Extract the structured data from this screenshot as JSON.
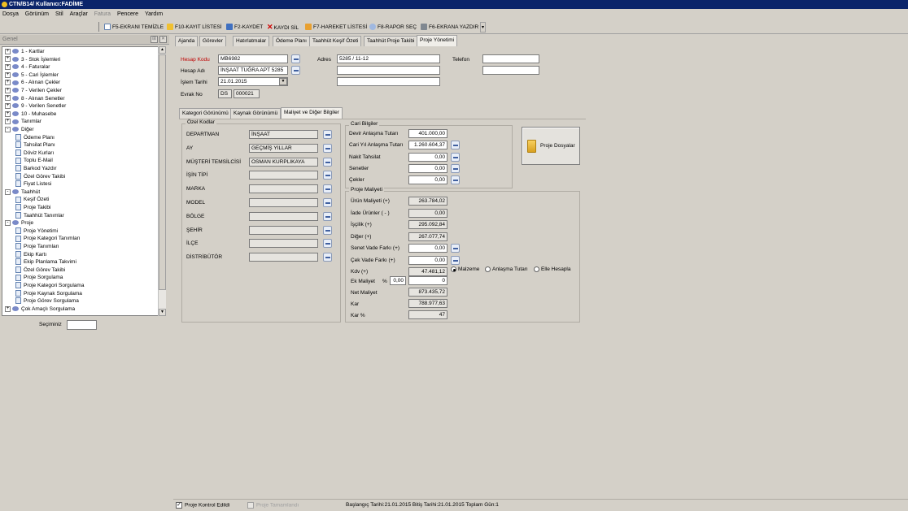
{
  "title": "CTN/B14/ Kullanıcı:FADİME",
  "menu": [
    {
      "label": "Dosya",
      "disabled": false
    },
    {
      "label": "Görünüm",
      "disabled": false
    },
    {
      "label": "Stil",
      "disabled": false
    },
    {
      "label": "Araçlar",
      "disabled": false
    },
    {
      "label": "Fatura",
      "disabled": true
    },
    {
      "label": "Pencere",
      "disabled": false
    },
    {
      "label": "Yardım",
      "disabled": false
    }
  ],
  "toolbar": {
    "f5": "F5-EKRANI TEMİZLE",
    "f10": "F10-KAYIT LİSTESİ",
    "f2": "F2-KAYDET",
    "delete": "KAYDI SİL",
    "f7": "F7-HAREKET LİSTESİ",
    "f8": "F8-RAPOR SEÇ",
    "f6": "F6-EKRANA YAZDIR"
  },
  "left_panel": {
    "header": "Genel",
    "tree": [
      {
        "label": "1 - Kartlar",
        "level": 0,
        "type": "folder",
        "exp": "+"
      },
      {
        "label": "3 - Stok İşlemleri",
        "level": 0,
        "type": "folder",
        "exp": "+"
      },
      {
        "label": "4 - Faturalar",
        "level": 0,
        "type": "folder",
        "exp": "+"
      },
      {
        "label": "5 - Cari İşlemler",
        "level": 0,
        "type": "folder",
        "exp": "+"
      },
      {
        "label": "6 - Alınan Çekler",
        "level": 0,
        "type": "folder",
        "exp": "+"
      },
      {
        "label": "7 - Verilen Çekler",
        "level": 0,
        "type": "folder",
        "exp": "+"
      },
      {
        "label": "8 - Alınan Senetler",
        "level": 0,
        "type": "folder",
        "exp": "+"
      },
      {
        "label": "9 - Verilen Senetler",
        "level": 0,
        "type": "folder",
        "exp": "+"
      },
      {
        "label": "10 - Muhasebe",
        "level": 0,
        "type": "folder",
        "exp": "+"
      },
      {
        "label": "Tanımlar",
        "level": 0,
        "type": "folder",
        "exp": "+"
      },
      {
        "label": "Diğer",
        "level": 0,
        "type": "folder",
        "exp": "-"
      },
      {
        "label": "Ödeme Planı",
        "level": 1,
        "type": "doc"
      },
      {
        "label": "Tahsilat Planı",
        "level": 1,
        "type": "doc"
      },
      {
        "label": "Döviz Kurları",
        "level": 1,
        "type": "doc"
      },
      {
        "label": "Toplu E-Mail",
        "level": 1,
        "type": "doc"
      },
      {
        "label": "Barkod Yazdır",
        "level": 1,
        "type": "doc"
      },
      {
        "label": "Özel Görev Takibi",
        "level": 1,
        "type": "doc"
      },
      {
        "label": "Fiyat Listesi",
        "level": 1,
        "type": "doc"
      },
      {
        "label": "Taahhüt",
        "level": 0,
        "type": "folder",
        "exp": "-"
      },
      {
        "label": "Keşif Özeti",
        "level": 1,
        "type": "doc"
      },
      {
        "label": "Proje Takibi",
        "level": 1,
        "type": "doc"
      },
      {
        "label": "Taahhüt Tanımlar",
        "level": 1,
        "type": "doc"
      },
      {
        "label": "Proje",
        "level": 0,
        "type": "folder",
        "exp": "-"
      },
      {
        "label": "Proje Yönetimi",
        "level": 1,
        "type": "doc"
      },
      {
        "label": "Proje Kategori Tanımları",
        "level": 1,
        "type": "doc"
      },
      {
        "label": "Proje Tanımları",
        "level": 1,
        "type": "doc"
      },
      {
        "label": "Ekip Kartı",
        "level": 1,
        "type": "doc"
      },
      {
        "label": "Ekip Planlama Takvimi",
        "level": 1,
        "type": "doc"
      },
      {
        "label": "Özel Görev Takibi",
        "level": 1,
        "type": "doc"
      },
      {
        "label": "Proje Sorgulama",
        "level": 1,
        "type": "doc"
      },
      {
        "label": "Proje Kategori Sorgulama",
        "level": 1,
        "type": "doc"
      },
      {
        "label": "Proje Kaynak Sorgulama",
        "level": 1,
        "type": "doc"
      },
      {
        "label": "Proje Görev Sorgulama",
        "level": 1,
        "type": "doc"
      },
      {
        "label": "Çok Amaçlı Sorgulama",
        "level": 0,
        "type": "folder",
        "exp": "+"
      }
    ],
    "secimimiz_label": "Seçiminiz"
  },
  "tabs": [
    "Ajanda",
    "Görevler",
    "Hatırlatmalar",
    "Ödeme Planı",
    "Taahhüt Keşif Özeti",
    "Taahhüt Proje Takibi",
    "Proje Yönetimi"
  ],
  "active_tab": "Proje Yönetimi",
  "form": {
    "hesap_kodu_label": "Hesap Kodu",
    "hesap_kodu": "MB6982",
    "hesap_adi_label": "Hesap Adı",
    "hesap_adi": "İNŞAAT TUĞRA APT 5285",
    "islem_tarihi_label": "İşlem Tarihi",
    "islem_tarihi": "21.01.2015",
    "evrak_no_label": "Evrak No",
    "evrak_seri": "DS",
    "evrak_no": "000021",
    "adres_label": "Adres",
    "adres1": "5285 / 11-12",
    "adres2": "",
    "adres3": "",
    "telefon_label": "Telefon",
    "telefon1": "",
    "telefon2": ""
  },
  "subtabs": [
    "Kategori Görünümü",
    "Kaynak Görünümü",
    "Maliyet ve Diğer Bilgiler"
  ],
  "active_subtab": "Maliyet ve Diğer Bilgiler",
  "ozel_kodlar": {
    "title": "Özel Kodlar",
    "rows": [
      {
        "label": "DEPARTMAN",
        "value": "İNŞAAT"
      },
      {
        "label": "AY",
        "value": "GEÇMİŞ YILLAR"
      },
      {
        "label": "MÜŞTERİ TEMSİLCİSİ",
        "value": "OSMAN KURPLIKAYA"
      },
      {
        "label": "İŞİN TİPİ",
        "value": ""
      },
      {
        "label": "MARKA",
        "value": ""
      },
      {
        "label": "MODEL",
        "value": ""
      },
      {
        "label": "BÖLGE",
        "value": ""
      },
      {
        "label": "ŞEHİR",
        "value": ""
      },
      {
        "label": "İLÇE",
        "value": ""
      },
      {
        "label": "DİSTRİBÜTÖR",
        "value": ""
      }
    ]
  },
  "cari_bilgiler": {
    "title": "Cari Bilgiler",
    "rows": [
      {
        "label": "Devir Anlaşma Tutarı",
        "value": "401.000,00",
        "pick": false
      },
      {
        "label": "Cari Yıl Anlaşma Tutarı",
        "value": "1.260.604,37",
        "pick": true
      },
      {
        "label": "Nakit Tahsilat",
        "value": "0,00",
        "pick": true
      },
      {
        "label": "Senetler",
        "value": "0,00",
        "pick": true
      },
      {
        "label": "Çekler",
        "value": "0,00",
        "pick": true
      }
    ]
  },
  "proje_dosyalar": "Proje Dosyalar",
  "proje_maliyeti": {
    "title": "Proje Maliyeti",
    "rows": [
      {
        "label": "Ürün Maliyeti (+)",
        "value": "263.784,02",
        "pick": false,
        "white": false
      },
      {
        "label": "İade Ürünler ( - )",
        "value": "0,00",
        "pick": false,
        "white": false
      },
      {
        "label": "İşçilik (+)",
        "value": "295.092,84",
        "pick": false,
        "white": false
      },
      {
        "label": "Diğer (+)",
        "value": "267.077,74",
        "pick": false,
        "white": false
      },
      {
        "label": "Senet Vade Farkı (+)",
        "value": "0,00",
        "pick": true,
        "white": true
      },
      {
        "label": "Çek Vade Farkı (+)",
        "value": "0,00",
        "pick": true,
        "white": true
      },
      {
        "label": "Kdv (+)",
        "value": "47.481,12",
        "pick": false,
        "white": false
      }
    ],
    "kdv_options": [
      "Malzeme",
      "Anlaşma Tutarı",
      "Elle Hesapla"
    ],
    "kdv_selected": "Malzeme",
    "ek_maliyet_label": "Ek Maliyet",
    "ek_pct_sign": "%",
    "ek_pct": "0,00",
    "ek_value": "0",
    "net_maliyet_label": "Net Maliyet",
    "net_maliyet": "873.435,72",
    "kar_label": "Kar",
    "kar": "788.977,63",
    "kar_pct_label": "Kar %",
    "kar_pct": "47"
  },
  "status": {
    "kontrol_label": "Proje Kontrol Edildi",
    "kontrol_checked": true,
    "tamamlandi_label": "Proje Tamamlandı",
    "tamamlandi_checked": false,
    "dates": "Başlangıç Tarihi:21.01.2015 Bitiş Tarihi:21.01.2015 Toplam Gün:1"
  }
}
